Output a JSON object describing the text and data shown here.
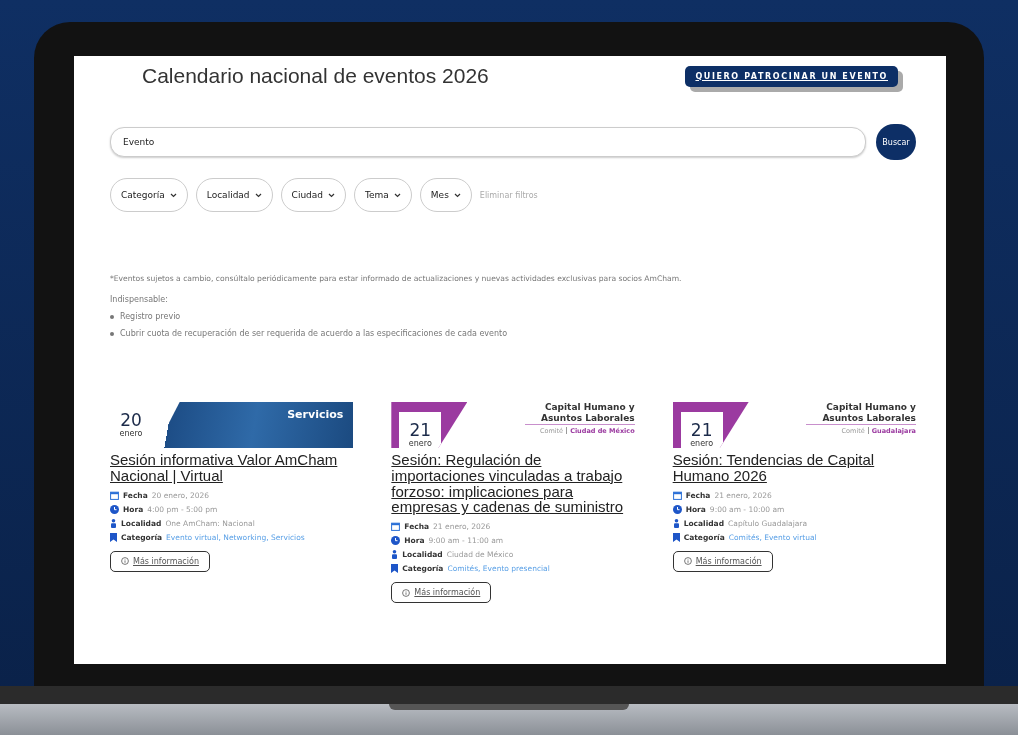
{
  "page": {
    "title": "Calendario nacional de eventos 2026",
    "sponsor_button": "QUIERO PATROCINAR UN EVENTO"
  },
  "search": {
    "value": "Evento",
    "button": "Buscar"
  },
  "filters": [
    {
      "label": "Categoría"
    },
    {
      "label": "Localidad"
    },
    {
      "label": "Ciudad"
    },
    {
      "label": "Tema"
    },
    {
      "label": "Mes"
    }
  ],
  "clear_filters": "Eliminar filtros",
  "notice": "*Eventos sujetos a cambio, consúltalo periódicamente para estar informado de actualizaciones y nuevas actividades exclusivas para socios AmCham.",
  "requirements": {
    "heading": "Indispensable:",
    "items": [
      "Registro previo",
      "Cubrir cuota de recuperación de ser requerida de acuerdo a las especificaciones de cada evento"
    ]
  },
  "events": [
    {
      "banner": {
        "kind": "image",
        "day": "20",
        "month": "enero",
        "label": "Servicios"
      },
      "title": "Sesión informativa Valor AmCham Nacional | Virtual",
      "details": [
        {
          "kind": "date",
          "label": "Fecha",
          "value": "20 enero, 2026"
        },
        {
          "kind": "time",
          "label": "Hora",
          "value": "4:00 pm - 5:00 pm"
        },
        {
          "kind": "location",
          "label": "Localidad",
          "value": "One AmCham: Nacional"
        },
        {
          "kind": "category",
          "label": "Categoría",
          "value": "Evento virtual, Networking, Servicios"
        }
      ],
      "button": "Más información"
    },
    {
      "banner": {
        "kind": "committee",
        "day": "21",
        "month": "enero",
        "label": "Capital Humano y Asuntos Laborales",
        "type": "Comité",
        "place": "Ciudad de México"
      },
      "title": "Sesión: Regulación de importaciones vinculadas a trabajo forzoso: implicaciones para empresas y cadenas de suministro",
      "details": [
        {
          "kind": "date",
          "label": "Fecha",
          "value": "21 enero, 2026"
        },
        {
          "kind": "time",
          "label": "Hora",
          "value": "9:00 am - 11:00 am"
        },
        {
          "kind": "location",
          "label": "Localidad",
          "value": "Ciudad de México"
        },
        {
          "kind": "category",
          "label": "Categoría",
          "value": "Comités, Evento presencial"
        }
      ],
      "button": "Más información"
    },
    {
      "banner": {
        "kind": "committee",
        "day": "21",
        "month": "enero",
        "label": "Capital Humano y Asuntos Laborales",
        "type": "Comité",
        "place": "Guadalajara"
      },
      "title": "Sesión: Tendencias de Capital Humano 2026",
      "details": [
        {
          "kind": "date",
          "label": "Fecha",
          "value": "21 enero, 2026"
        },
        {
          "kind": "time",
          "label": "Hora",
          "value": "9:00 am - 10:00 am"
        },
        {
          "kind": "location",
          "label": "Localidad",
          "value": "Capítulo Guadalajara"
        },
        {
          "kind": "category",
          "label": "Categoría",
          "value": "Comités, Evento virtual"
        }
      ],
      "button": "Más información"
    }
  ]
}
